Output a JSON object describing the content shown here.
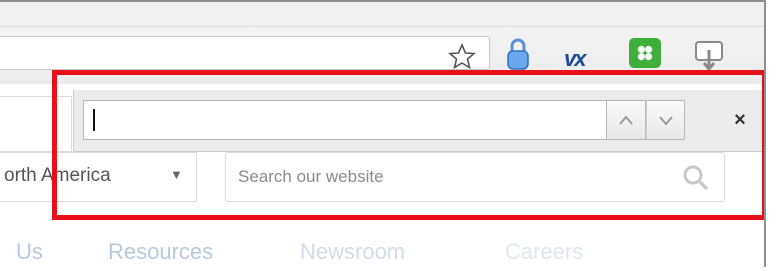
{
  "browser": {
    "extensions": [
      "lock-extension-icon",
      "vx-extension-icon",
      "green-app-icon",
      "tray-download-icon"
    ],
    "vx_label": "vx"
  },
  "find_bar": {
    "input_value": "",
    "prev_icon": "chevron-up-icon",
    "next_icon": "chevron-down-icon",
    "close_label": "×"
  },
  "page": {
    "region_select_value": "orth America",
    "region_arrow": "▼",
    "search_placeholder": "Search our website",
    "nav_items": [
      "Us",
      "Resources",
      "Newsroom",
      "Careers"
    ]
  },
  "colors": {
    "highlight": "#e8101b",
    "nav_text": "#b7c9dd",
    "vx_brand": "#1b4a9c",
    "green_app": "#3fae3a"
  }
}
